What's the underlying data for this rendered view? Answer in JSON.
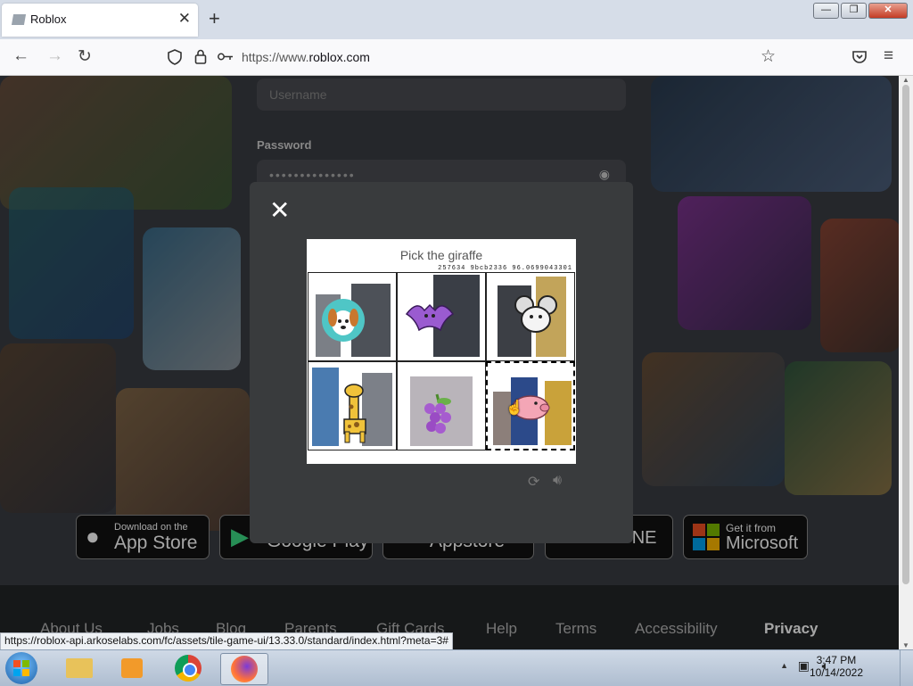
{
  "browser": {
    "tab_title": "Roblox",
    "tab_close": "✕",
    "new_tab": "+",
    "url_prefix": "https://www.",
    "url_domain": "roblox.com",
    "status_url": "https://roblox-api.arkoselabs.com/fc/assets/tile-game-ui/13.33.0/standard/index.html?meta=3#",
    "window_buttons": [
      "—",
      "❐",
      "✕"
    ]
  },
  "login": {
    "username_placeholder": "Username",
    "password_label": "Password",
    "password_mask": "••••••••••••••"
  },
  "badges": {
    "appstore_top": "Download on the",
    "appstore_main": "App Store",
    "googleplay_main": "Google Play",
    "amazon_main": "Appstore",
    "xbox_main": "XBOX ONE",
    "microsoft_top": "Get it from",
    "microsoft_main": "Microsoft"
  },
  "footer": {
    "links": [
      "About Us",
      "Jobs",
      "Blog",
      "Parents",
      "Gift Cards",
      "Help",
      "Terms",
      "Accessibility",
      "Privacy"
    ]
  },
  "captcha": {
    "close_label": "✕",
    "title": "Pick the giraffe",
    "code": "257634 9bcb2336 96.0699043301",
    "tiles": [
      {
        "name": "dog",
        "selected": false
      },
      {
        "name": "bat",
        "selected": false
      },
      {
        "name": "mouse",
        "selected": false
      },
      {
        "name": "giraffe",
        "selected": false
      },
      {
        "name": "grapes",
        "selected": false
      },
      {
        "name": "pig",
        "selected": true
      }
    ],
    "reload_icon": "reload-icon",
    "audio_icon": "audio-icon"
  },
  "taskbar": {
    "time": "3:47 PM",
    "date": "10/14/2022",
    "pinned": [
      "explorer-icon",
      "media-player-icon",
      "chrome-icon",
      "firefox-icon"
    ]
  }
}
